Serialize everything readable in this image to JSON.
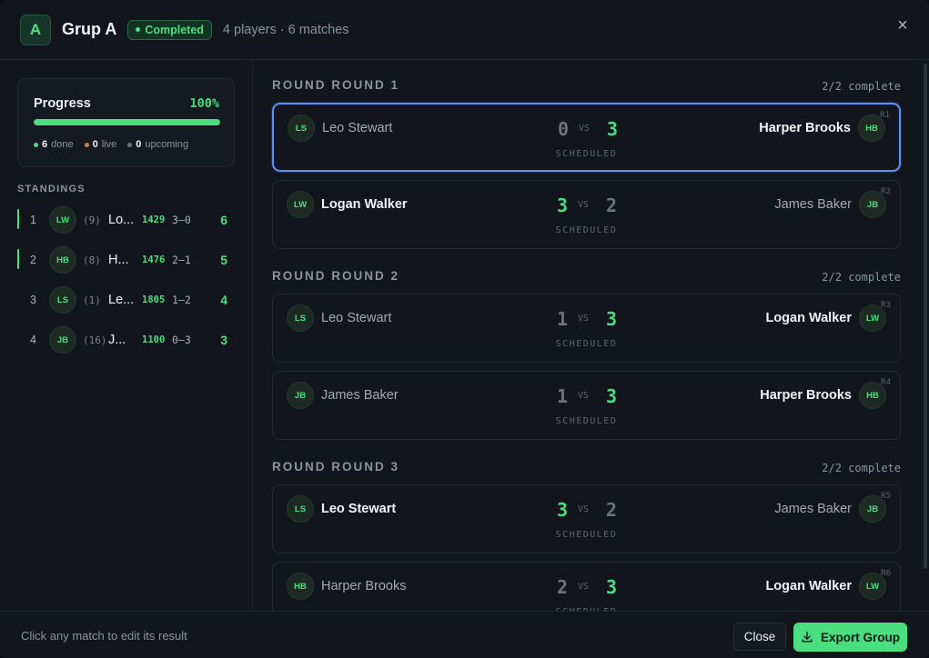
{
  "header": {
    "avatar_letter": "A",
    "title": "Grup A",
    "status": "Completed",
    "meta": "4 players · 6 matches",
    "close_glyph": "×"
  },
  "progress": {
    "title": "Progress",
    "percent_label": "100%",
    "fill_fraction": 1.0,
    "done_count": "6",
    "done_label": "done",
    "live_count": "0",
    "live_label": "live",
    "upcoming_count": "0",
    "upcoming_label": "upcoming",
    "colors": {
      "done": "#4ade80",
      "live": "#d97a3a",
      "upcoming": "#6b7380"
    }
  },
  "standings": {
    "title": "STANDINGS",
    "rows": [
      {
        "rank": "1",
        "initials": "LW",
        "seed": "(9)",
        "name": "Lo...",
        "elo": "1429",
        "record": "3–0",
        "points": "6",
        "highlight": true
      },
      {
        "rank": "2",
        "initials": "HB",
        "seed": "(8)",
        "name": "H...",
        "elo": "1476",
        "record": "2–1",
        "points": "5",
        "highlight": true
      },
      {
        "rank": "3",
        "initials": "LS",
        "seed": "(1)",
        "name": "Le...",
        "elo": "1805",
        "record": "1–2",
        "points": "4",
        "highlight": false
      },
      {
        "rank": "4",
        "initials": "JB",
        "seed": "(16)",
        "name": "J...",
        "elo": "1100",
        "record": "0–3",
        "points": "3",
        "highlight": false
      }
    ]
  },
  "rounds": [
    {
      "title": "ROUND ROUND 1",
      "status": "2/2 complete",
      "matches": [
        {
          "tag": "R1",
          "left_initials": "LS",
          "left_name": "Leo Stewart",
          "left_score": "0",
          "right_score": "3",
          "right_name": "Harper Brooks",
          "right_initials": "HB",
          "winner": "right",
          "vs": "VS",
          "state": "SCHEDULED",
          "selected": true
        },
        {
          "tag": "R2",
          "left_initials": "LW",
          "left_name": "Logan Walker",
          "left_score": "3",
          "right_score": "2",
          "right_name": "James Baker",
          "right_initials": "JB",
          "winner": "left",
          "vs": "VS",
          "state": "SCHEDULED",
          "selected": false
        }
      ]
    },
    {
      "title": "ROUND ROUND 2",
      "status": "2/2 complete",
      "matches": [
        {
          "tag": "R3",
          "left_initials": "LS",
          "left_name": "Leo Stewart",
          "left_score": "1",
          "right_score": "3",
          "right_name": "Logan Walker",
          "right_initials": "LW",
          "winner": "right",
          "vs": "VS",
          "state": "SCHEDULED",
          "selected": false
        },
        {
          "tag": "R4",
          "left_initials": "JB",
          "left_name": "James Baker",
          "left_score": "1",
          "right_score": "3",
          "right_name": "Harper Brooks",
          "right_initials": "HB",
          "winner": "right",
          "vs": "VS",
          "state": "SCHEDULED",
          "selected": false
        }
      ]
    },
    {
      "title": "ROUND ROUND 3",
      "status": "2/2 complete",
      "matches": [
        {
          "tag": "R5",
          "left_initials": "LS",
          "left_name": "Leo Stewart",
          "left_score": "3",
          "right_score": "2",
          "right_name": "James Baker",
          "right_initials": "JB",
          "winner": "left",
          "vs": "VS",
          "state": "SCHEDULED",
          "selected": false
        },
        {
          "tag": "R6",
          "left_initials": "HB",
          "left_name": "Harper Brooks",
          "left_score": "2",
          "right_score": "3",
          "right_name": "Logan Walker",
          "right_initials": "LW",
          "winner": "right",
          "vs": "VS",
          "state": "SCHEDULED",
          "selected": false
        }
      ]
    }
  ],
  "footer": {
    "hint": "Click any match to edit its result",
    "close_label": "Close",
    "export_label": "Export Group",
    "export_icon": "download-icon"
  }
}
